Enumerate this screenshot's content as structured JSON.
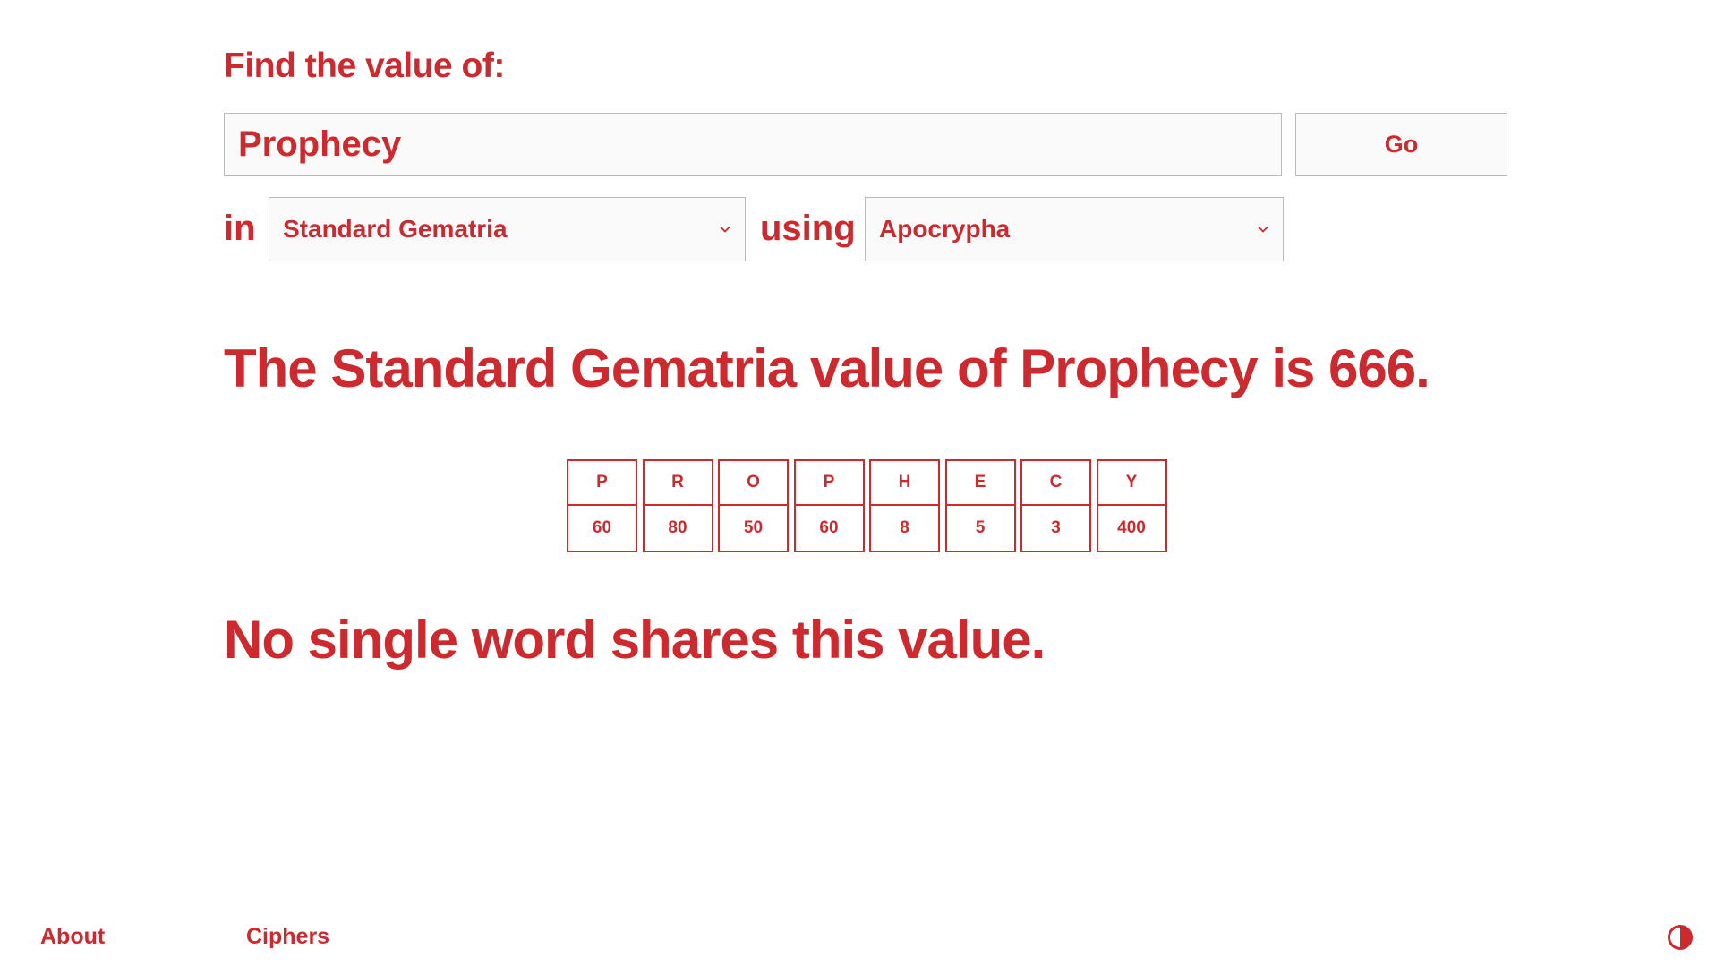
{
  "colors": {
    "accent": "#cc2a2f",
    "field_background": "#fafafa",
    "field_border": "#b9b9b9",
    "page_background": "#ffffff"
  },
  "search": {
    "label": "Find the value of:",
    "value": "Prophecy",
    "go_label": "Go"
  },
  "options": {
    "in_label": "in",
    "cipher_selected": "Standard Gematria",
    "using_label": "using",
    "corpus_selected": "Apocrypha",
    "chevron_icon": "chevron-down-icon"
  },
  "result": {
    "heading": "The Standard Gematria value of Prophecy is 666.",
    "letters": [
      {
        "letter": "P",
        "value": "60"
      },
      {
        "letter": "R",
        "value": "80"
      },
      {
        "letter": "O",
        "value": "50"
      },
      {
        "letter": "P",
        "value": "60"
      },
      {
        "letter": "H",
        "value": "8"
      },
      {
        "letter": "E",
        "value": "5"
      },
      {
        "letter": "C",
        "value": "3"
      },
      {
        "letter": "Y",
        "value": "400"
      }
    ],
    "matches_text": "No single word shares this value."
  },
  "footer": {
    "about_label": "About",
    "ciphers_label": "Ciphers",
    "theme_icon": "contrast-icon"
  }
}
